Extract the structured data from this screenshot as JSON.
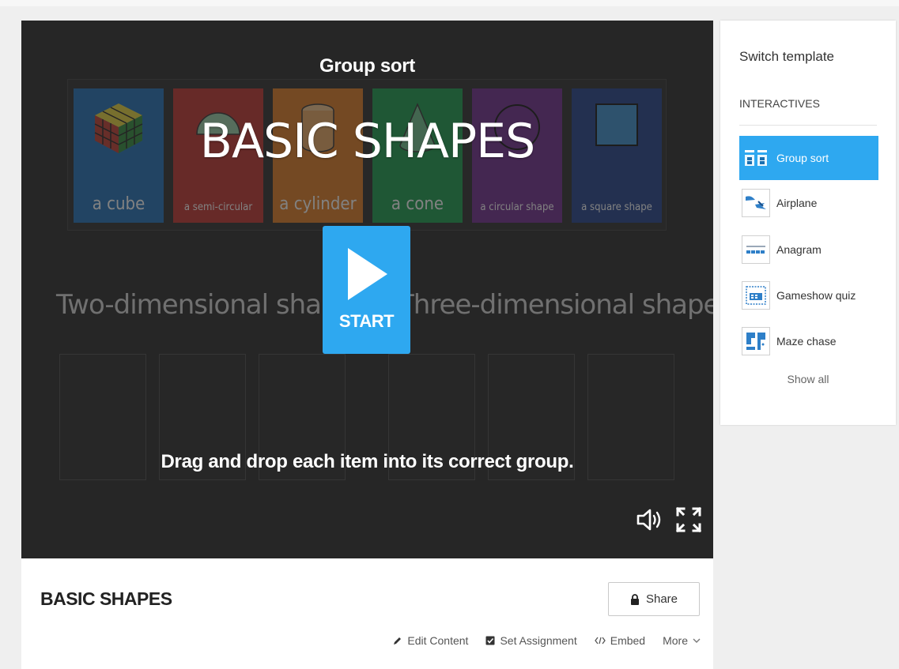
{
  "game": {
    "type_label": "Group sort",
    "title": "BASIC SHAPES",
    "start_label": "START",
    "instructions": "Drag and drop each item into its correct group.",
    "items": [
      {
        "label": "a cube"
      },
      {
        "label": "a semi-circular"
      },
      {
        "label": "a cylinder"
      },
      {
        "label": "a cone"
      },
      {
        "label": "a circular shape"
      },
      {
        "label": "a square shape"
      }
    ],
    "groups": [
      {
        "title": "Two-dimensional shapes"
      },
      {
        "title": "Three-dimensional shapes"
      }
    ],
    "colors": {
      "card_blue": "#1e6fb8",
      "card_red": "#c2312b",
      "card_orange": "#e07a20",
      "card_green": "#169c4b",
      "card_purple": "#6e2a8c",
      "card_navy": "#1f3f8a",
      "accent": "#2ea8f0"
    }
  },
  "info": {
    "title": "BASIC SHAPES",
    "share_label": "Share",
    "actions": {
      "edit": "Edit Content",
      "assign": "Set Assignment",
      "embed": "Embed",
      "more": "More"
    }
  },
  "sidebar": {
    "title": "Switch template",
    "section": "INTERACTIVES",
    "templates": [
      {
        "label": "Group sort",
        "icon": "group-sort-icon",
        "active": true
      },
      {
        "label": "Airplane",
        "icon": "airplane-icon",
        "active": false
      },
      {
        "label": "Anagram",
        "icon": "anagram-icon",
        "active": false
      },
      {
        "label": "Gameshow quiz",
        "icon": "gameshow-quiz-icon",
        "active": false
      },
      {
        "label": "Maze chase",
        "icon": "maze-chase-icon",
        "active": false
      }
    ],
    "show_all": "Show all"
  }
}
